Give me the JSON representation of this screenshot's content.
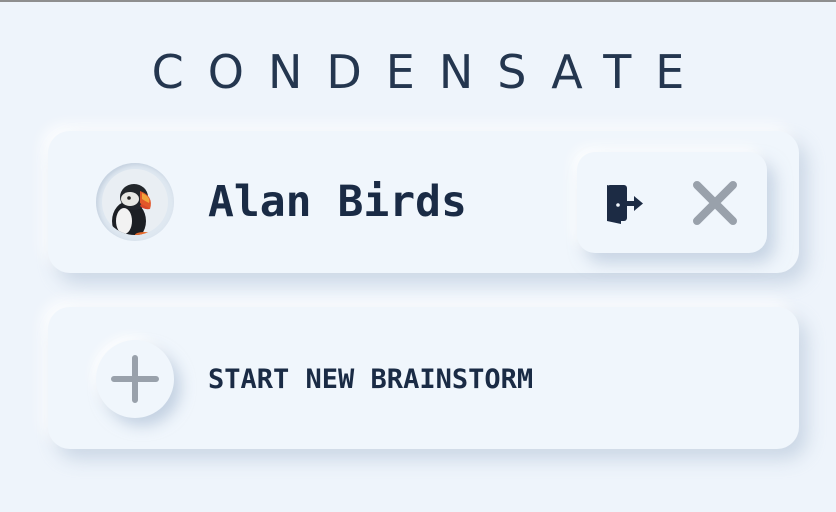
{
  "app": {
    "title": "CONDENSATE"
  },
  "user": {
    "name": "Alan Birds",
    "avatar_icon": "puffin-avatar"
  },
  "actions": {
    "logout_icon": "logout-door-icon",
    "close_icon": "close-icon"
  },
  "new_brainstorm": {
    "label": "START NEW BRAINSTORM",
    "icon": "plus-icon"
  },
  "colors": {
    "background": "#eef4fb",
    "card": "#f0f6fc",
    "text_dark": "#1a2b45",
    "icon_gray": "#99a1ab"
  }
}
